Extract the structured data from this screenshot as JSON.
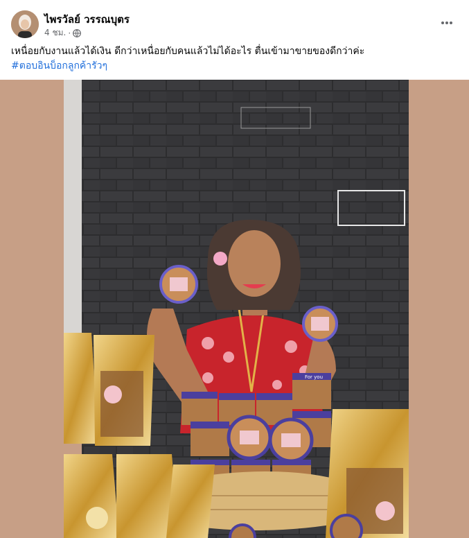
{
  "post": {
    "author": "ไพรวัลย์ วรรณบุตร",
    "time": "4 ชม.",
    "separator": "·",
    "privacy_icon": "globe-icon",
    "more_icon": "more-horizontal-icon",
    "text": "เหนื่อยกับงานแล้วได้เงิน ดีกว่าเหนื่อยกับคนแล้วไม่ได้อะไร ตื่นเข้ามาขายของดีกว่าค่ะ",
    "hashtag": "#ตอบอินบ็อกลูกค้ารัวๆ"
  },
  "photo": {
    "jar_label": "For you",
    "colors": {
      "backdrop": "#c79f86",
      "wall": "#2f2f31",
      "dress": "#c8242c",
      "jar_lid": "#4b3f9e",
      "gold_bag": "#d9b054"
    }
  }
}
